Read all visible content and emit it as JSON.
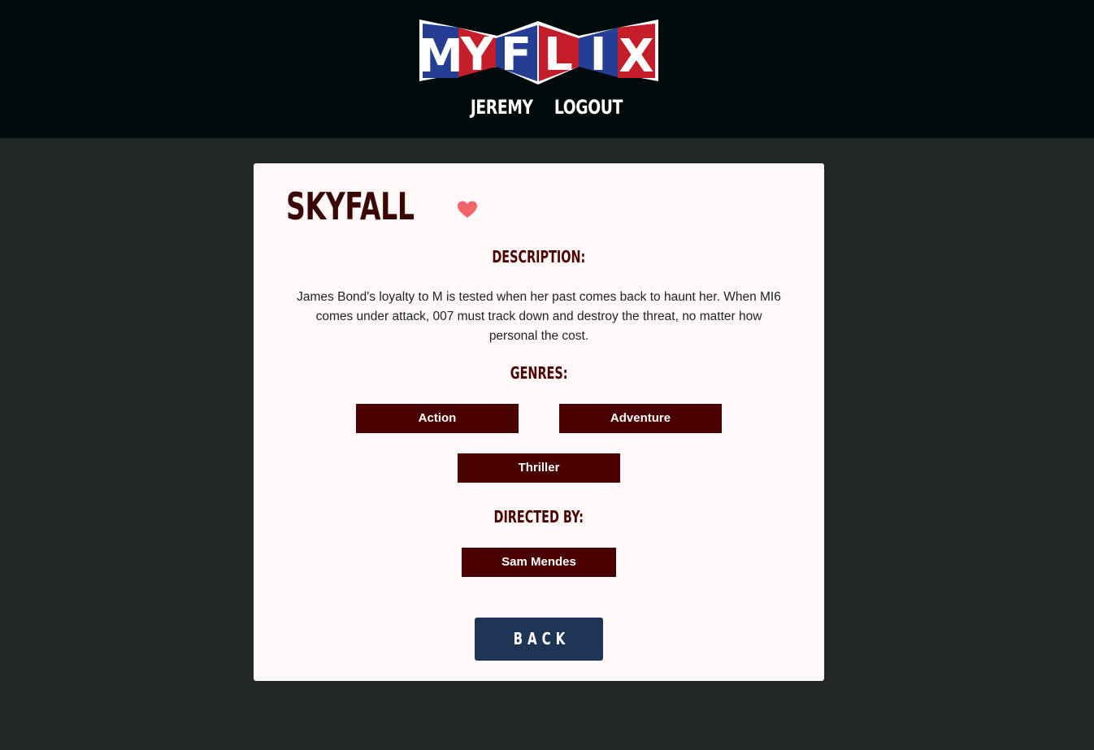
{
  "header": {
    "logo_text": "MYFLIX",
    "nav": {
      "user_label": "JEREMY",
      "logout_label": "LOGOUT"
    }
  },
  "movie": {
    "title": "SKYFALL",
    "favorite": true,
    "description_heading": "DESCRIPTION:",
    "description": "James Bond's loyalty to M is tested when her past comes back to haunt her. When MI6 comes under attack, 007 must track down and destroy the threat, no matter how personal the cost.",
    "genres_heading": "GENRES:",
    "genres": [
      "Action",
      "Adventure",
      "Thriller"
    ],
    "director_heading": "DIRECTED BY:",
    "director": "Sam Mendes"
  },
  "actions": {
    "back_label": "BACK"
  },
  "colors": {
    "header_bg": "#010b0b",
    "page_bg": "#212727",
    "card_bg": "#fef9f8",
    "heading": "#4d0000",
    "tag_bg": "#4b0000",
    "button_bg": "#1f3556",
    "heart": "#f2646c",
    "logo_red": "#c41e2a",
    "logo_blue": "#253e94"
  }
}
